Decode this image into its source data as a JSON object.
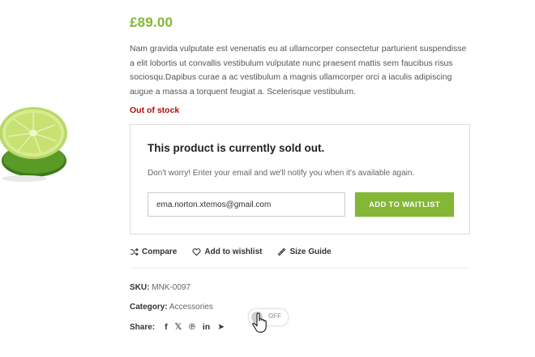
{
  "product": {
    "price": "£89.00",
    "description": "Nam gravida vulputate est venenatis eu at ullamcorper consectetur parturient suspendisse a elit lobortis ut convallis vestibulum vulputate nunc praesent mattis sem faucibus risus sociosqu.Dapibus curae a ac vestibulum a magnis ullamcorper orci a iaculis adipiscing augue a massa a torquent feugiat a. Scelerisque vestibulum.",
    "stock_status": "Out of stock"
  },
  "waitlist": {
    "title": "This product is currently sold out.",
    "message": "Don't worry! Enter your email and we'll notify you when it's available again.",
    "email_value": "ema.norton.xtemos@gmail.com",
    "button_label": "ADD TO WAITLIST"
  },
  "actions": {
    "compare": "Compare",
    "wishlist": "Add to wishlist",
    "size_guide": "Size Guide"
  },
  "meta": {
    "sku_label": "SKU:",
    "sku_value": "MNK-0097",
    "category_label": "Category:",
    "category_value": "Accessories",
    "share_label": "Share:"
  },
  "share_icons": {
    "facebook": "f",
    "x": "𝕏",
    "pinterest": "℗",
    "linkedin": "in",
    "telegram": "➤"
  },
  "toggle": {
    "label": "OFF"
  },
  "colors": {
    "accent": "#83b735",
    "out_of_stock": "#b50b0b"
  }
}
